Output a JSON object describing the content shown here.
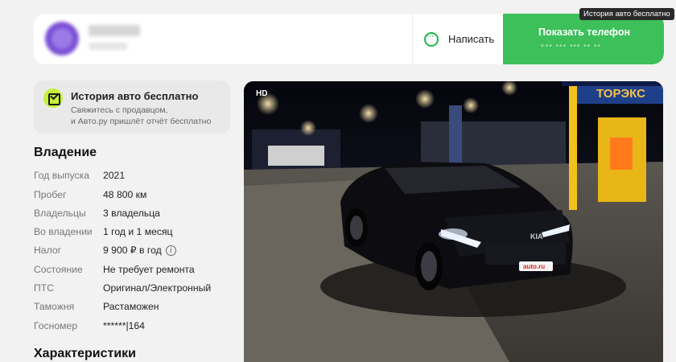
{
  "seller": {
    "write_label": "Написать",
    "show_phone_label": "Показать телефон",
    "phone_masked": "+•• ••• ••• •• ••"
  },
  "tooltip": "История авто бесплатно",
  "history": {
    "title": "История авто бесплатно",
    "line1": "Свяжитесь с продавцом,",
    "line2": "и Авто.ру пришлёт отчёт бесплатно"
  },
  "ownership": {
    "title": "Владение",
    "rows": [
      {
        "label": "Год выпуска",
        "value": "2021"
      },
      {
        "label": "Пробег",
        "value": "48 800 км"
      },
      {
        "label": "Владельцы",
        "value": "3 владельца"
      },
      {
        "label": "Во владении",
        "value": "1 год и 1 месяц"
      },
      {
        "label": "Налог",
        "value": "9 900 ₽ в год"
      },
      {
        "label": "Состояние",
        "value": "Не требует ремонта"
      },
      {
        "label": "ПТС",
        "value": "Оригинал/Электронный"
      },
      {
        "label": "Таможня",
        "value": "Растаможен"
      },
      {
        "label": "Госномер",
        "value": "******|164"
      }
    ]
  },
  "specs": {
    "title": "Характеристики"
  },
  "photo": {
    "badge": "HD",
    "station_sign": "ТОРЭКС",
    "plate_logo": "auto.ru",
    "car_badge": "KIA"
  }
}
